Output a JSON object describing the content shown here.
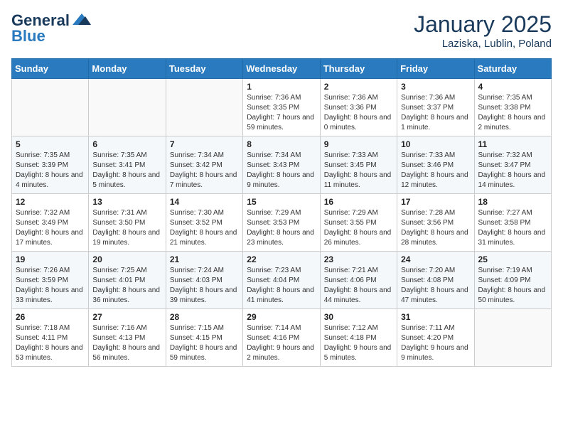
{
  "logo": {
    "general": "General",
    "blue": "Blue"
  },
  "title": "January 2025",
  "subtitle": "Laziska, Lublin, Poland",
  "days_header": [
    "Sunday",
    "Monday",
    "Tuesday",
    "Wednesday",
    "Thursday",
    "Friday",
    "Saturday"
  ],
  "weeks": [
    [
      {
        "num": "",
        "sunrise": "",
        "sunset": "",
        "daylight": ""
      },
      {
        "num": "",
        "sunrise": "",
        "sunset": "",
        "daylight": ""
      },
      {
        "num": "",
        "sunrise": "",
        "sunset": "",
        "daylight": ""
      },
      {
        "num": "1",
        "sunrise": "Sunrise: 7:36 AM",
        "sunset": "Sunset: 3:35 PM",
        "daylight": "Daylight: 7 hours and 59 minutes."
      },
      {
        "num": "2",
        "sunrise": "Sunrise: 7:36 AM",
        "sunset": "Sunset: 3:36 PM",
        "daylight": "Daylight: 8 hours and 0 minutes."
      },
      {
        "num": "3",
        "sunrise": "Sunrise: 7:36 AM",
        "sunset": "Sunset: 3:37 PM",
        "daylight": "Daylight: 8 hours and 1 minute."
      },
      {
        "num": "4",
        "sunrise": "Sunrise: 7:35 AM",
        "sunset": "Sunset: 3:38 PM",
        "daylight": "Daylight: 8 hours and 2 minutes."
      }
    ],
    [
      {
        "num": "5",
        "sunrise": "Sunrise: 7:35 AM",
        "sunset": "Sunset: 3:39 PM",
        "daylight": "Daylight: 8 hours and 4 minutes."
      },
      {
        "num": "6",
        "sunrise": "Sunrise: 7:35 AM",
        "sunset": "Sunset: 3:41 PM",
        "daylight": "Daylight: 8 hours and 5 minutes."
      },
      {
        "num": "7",
        "sunrise": "Sunrise: 7:34 AM",
        "sunset": "Sunset: 3:42 PM",
        "daylight": "Daylight: 8 hours and 7 minutes."
      },
      {
        "num": "8",
        "sunrise": "Sunrise: 7:34 AM",
        "sunset": "Sunset: 3:43 PM",
        "daylight": "Daylight: 8 hours and 9 minutes."
      },
      {
        "num": "9",
        "sunrise": "Sunrise: 7:33 AM",
        "sunset": "Sunset: 3:45 PM",
        "daylight": "Daylight: 8 hours and 11 minutes."
      },
      {
        "num": "10",
        "sunrise": "Sunrise: 7:33 AM",
        "sunset": "Sunset: 3:46 PM",
        "daylight": "Daylight: 8 hours and 12 minutes."
      },
      {
        "num": "11",
        "sunrise": "Sunrise: 7:32 AM",
        "sunset": "Sunset: 3:47 PM",
        "daylight": "Daylight: 8 hours and 14 minutes."
      }
    ],
    [
      {
        "num": "12",
        "sunrise": "Sunrise: 7:32 AM",
        "sunset": "Sunset: 3:49 PM",
        "daylight": "Daylight: 8 hours and 17 minutes."
      },
      {
        "num": "13",
        "sunrise": "Sunrise: 7:31 AM",
        "sunset": "Sunset: 3:50 PM",
        "daylight": "Daylight: 8 hours and 19 minutes."
      },
      {
        "num": "14",
        "sunrise": "Sunrise: 7:30 AM",
        "sunset": "Sunset: 3:52 PM",
        "daylight": "Daylight: 8 hours and 21 minutes."
      },
      {
        "num": "15",
        "sunrise": "Sunrise: 7:29 AM",
        "sunset": "Sunset: 3:53 PM",
        "daylight": "Daylight: 8 hours and 23 minutes."
      },
      {
        "num": "16",
        "sunrise": "Sunrise: 7:29 AM",
        "sunset": "Sunset: 3:55 PM",
        "daylight": "Daylight: 8 hours and 26 minutes."
      },
      {
        "num": "17",
        "sunrise": "Sunrise: 7:28 AM",
        "sunset": "Sunset: 3:56 PM",
        "daylight": "Daylight: 8 hours and 28 minutes."
      },
      {
        "num": "18",
        "sunrise": "Sunrise: 7:27 AM",
        "sunset": "Sunset: 3:58 PM",
        "daylight": "Daylight: 8 hours and 31 minutes."
      }
    ],
    [
      {
        "num": "19",
        "sunrise": "Sunrise: 7:26 AM",
        "sunset": "Sunset: 3:59 PM",
        "daylight": "Daylight: 8 hours and 33 minutes."
      },
      {
        "num": "20",
        "sunrise": "Sunrise: 7:25 AM",
        "sunset": "Sunset: 4:01 PM",
        "daylight": "Daylight: 8 hours and 36 minutes."
      },
      {
        "num": "21",
        "sunrise": "Sunrise: 7:24 AM",
        "sunset": "Sunset: 4:03 PM",
        "daylight": "Daylight: 8 hours and 39 minutes."
      },
      {
        "num": "22",
        "sunrise": "Sunrise: 7:23 AM",
        "sunset": "Sunset: 4:04 PM",
        "daylight": "Daylight: 8 hours and 41 minutes."
      },
      {
        "num": "23",
        "sunrise": "Sunrise: 7:21 AM",
        "sunset": "Sunset: 4:06 PM",
        "daylight": "Daylight: 8 hours and 44 minutes."
      },
      {
        "num": "24",
        "sunrise": "Sunrise: 7:20 AM",
        "sunset": "Sunset: 4:08 PM",
        "daylight": "Daylight: 8 hours and 47 minutes."
      },
      {
        "num": "25",
        "sunrise": "Sunrise: 7:19 AM",
        "sunset": "Sunset: 4:09 PM",
        "daylight": "Daylight: 8 hours and 50 minutes."
      }
    ],
    [
      {
        "num": "26",
        "sunrise": "Sunrise: 7:18 AM",
        "sunset": "Sunset: 4:11 PM",
        "daylight": "Daylight: 8 hours and 53 minutes."
      },
      {
        "num": "27",
        "sunrise": "Sunrise: 7:16 AM",
        "sunset": "Sunset: 4:13 PM",
        "daylight": "Daylight: 8 hours and 56 minutes."
      },
      {
        "num": "28",
        "sunrise": "Sunrise: 7:15 AM",
        "sunset": "Sunset: 4:15 PM",
        "daylight": "Daylight: 8 hours and 59 minutes."
      },
      {
        "num": "29",
        "sunrise": "Sunrise: 7:14 AM",
        "sunset": "Sunset: 4:16 PM",
        "daylight": "Daylight: 9 hours and 2 minutes."
      },
      {
        "num": "30",
        "sunrise": "Sunrise: 7:12 AM",
        "sunset": "Sunset: 4:18 PM",
        "daylight": "Daylight: 9 hours and 5 minutes."
      },
      {
        "num": "31",
        "sunrise": "Sunrise: 7:11 AM",
        "sunset": "Sunset: 4:20 PM",
        "daylight": "Daylight: 9 hours and 9 minutes."
      },
      {
        "num": "",
        "sunrise": "",
        "sunset": "",
        "daylight": ""
      }
    ]
  ]
}
